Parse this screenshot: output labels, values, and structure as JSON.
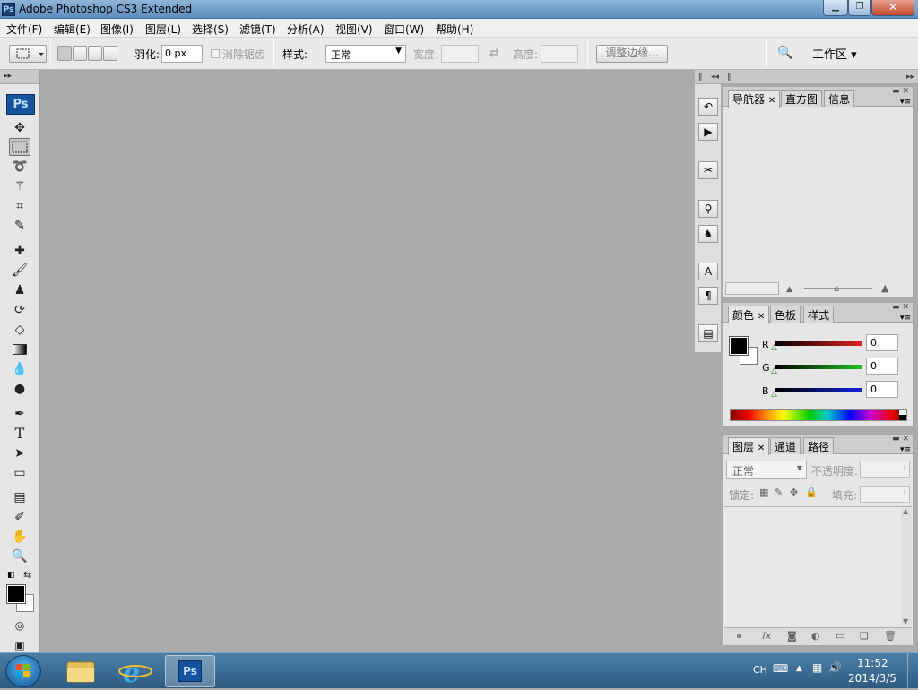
{
  "window": {
    "title": "Adobe Photoshop CS3 Extended",
    "app_icon": "Ps",
    "min_label": "▁",
    "max_label": "❐",
    "close_label": "✕"
  },
  "menubar": {
    "items": [
      "文件(F)",
      "编辑(E)",
      "图像(I)",
      "图层(L)",
      "选择(S)",
      "滤镜(T)",
      "分析(A)",
      "视图(V)",
      "窗口(W)",
      "帮助(H)"
    ]
  },
  "options": {
    "feather_label": "羽化:",
    "feather_value": "0 px",
    "antialias_label": "消除锯齿",
    "style_label": "样式:",
    "style_value": "正常",
    "width_label": "宽度:",
    "height_label": "高度:",
    "refine_edge_button": "调整边缘...",
    "workspace_button": "工作区 ▾"
  },
  "toolbox": {
    "logo": "Ps"
  },
  "panels": {
    "navigator": {
      "tabs": [
        "导航器",
        "直方图",
        "信息"
      ]
    },
    "color": {
      "tabs": [
        "颜色",
        "色板",
        "样式"
      ],
      "channels": [
        {
          "label": "R",
          "value": "0",
          "color": "#e02020"
        },
        {
          "label": "G",
          "value": "0",
          "color": "#20c020"
        },
        {
          "label": "B",
          "value": "0",
          "color": "#1020e0"
        }
      ]
    },
    "layers": {
      "tabs": [
        "图层",
        "通道",
        "路径"
      ],
      "blend_mode": "正常",
      "opacity_label": "不透明度:",
      "lock_label": "锁定:",
      "fill_label": "填充:"
    }
  },
  "taskbar": {
    "lang": "CH",
    "time": "11:52",
    "date": "2014/3/5"
  }
}
